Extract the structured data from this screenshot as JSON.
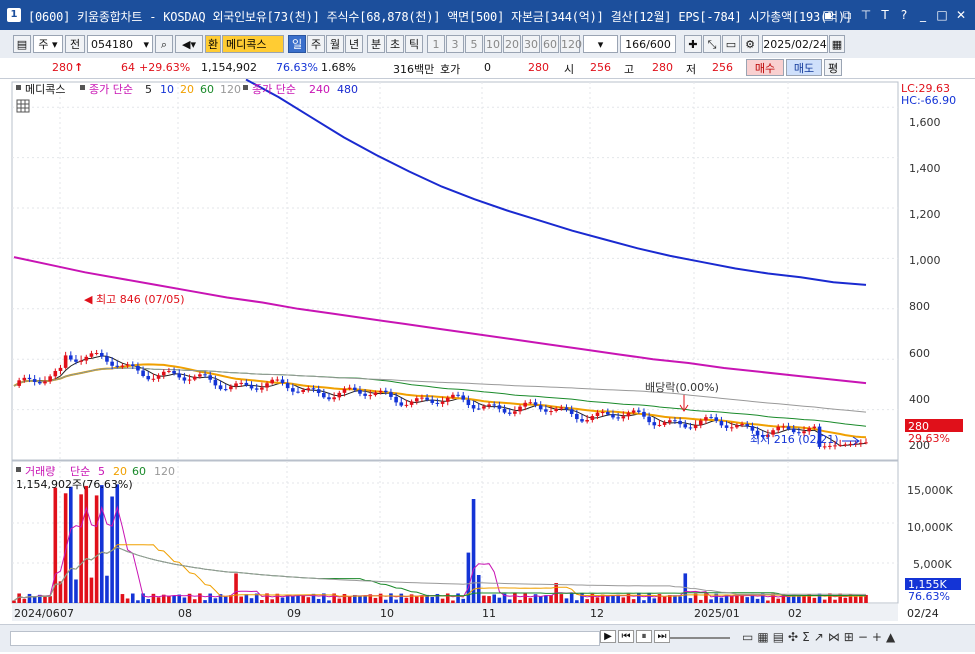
{
  "window": {
    "number": "1",
    "title": "[0600] 키움종합차트 - KOSDAQ 외국인보유[73(천)] 주식수[68,878(천)] 액면[500] 자본금[344(억)] 결산[12월] EPS[-784] 시가총액[193(억)]",
    "buttons": [
      "▣",
      "⧉",
      "⊤",
      "T",
      "?",
      "_",
      "□",
      "✕"
    ]
  },
  "toolbar": {
    "period_select": "주",
    "prev_label": "전",
    "code": "054180",
    "exchange_label": "환",
    "stock_name": "메디콕스",
    "period_tabs": [
      "일",
      "주",
      "월",
      "년",
      "분",
      "초",
      "틱"
    ],
    "active_period": "일",
    "minute_options": [
      "1",
      "3",
      "5",
      "10",
      "20",
      "30",
      "60",
      "120"
    ],
    "count_value": "166",
    "count_max": "/600",
    "date": "2025/02/24"
  },
  "quote": {
    "price": "280",
    "change": "64",
    "change_pct": "+29.63%",
    "volume": "1,154,902",
    "ratio1": "76.63%",
    "ratio2": "1.68%",
    "amount": "316백만",
    "hoga_label": "호가",
    "hoga_value": "0",
    "hoga_price": "280",
    "open_label": "시",
    "open": "256",
    "high_label": "고",
    "high": "280",
    "low_label": "저",
    "low": "256",
    "buy_label": "매수",
    "sell_label": "매도",
    "eval_label": "평"
  },
  "colors": {
    "up": "#e0101a",
    "down": "#1434d6",
    "ma5": "#222222",
    "ma20": "#f0a000",
    "ma60": "#1a8a2a",
    "ma120": "#999999",
    "ma240": "#c814b4",
    "ma480": "#1a2ad0"
  },
  "price_panel": {
    "legend": {
      "name": "메디콕스",
      "ma_label": "종가 단순",
      "periods": [
        "5",
        "10",
        "20",
        "60",
        "120"
      ],
      "ma2_label": "종가 단순",
      "periods2": [
        "240",
        "480"
      ]
    },
    "lc": "LC:29.63",
    "hc": "HC:-66.90",
    "current_price_tag": "280",
    "current_pct_tag": "29.63%",
    "y_ticks": [
      "1,600",
      "1,400",
      "1,200",
      "1,000",
      "800",
      "600",
      "400",
      "200"
    ],
    "high_annotation": "최고 846 (07/05)",
    "low_annotation": "최저 216 (02/21)",
    "dividend_annotation": "배당락(0.00%)"
  },
  "volume_panel": {
    "legend_name": "거래량",
    "ma_label": "단순",
    "periods": [
      "5",
      "20",
      "60",
      "120"
    ],
    "value_label": "1,154,902주(76.63%)",
    "y_ticks": [
      "15,000K",
      "10,000K",
      "5,000K"
    ],
    "current_tag": "1,155K",
    "current_pct_tag": "76.63%"
  },
  "x_axis": {
    "labels": [
      "2024/06",
      "07",
      "08",
      "09",
      "10",
      "11",
      "12",
      "2025/01",
      "02"
    ],
    "last_date": "02/24"
  },
  "chart_data": {
    "type": "candlestick",
    "price_range": [
      200,
      1700
    ],
    "ma240": [
      1005,
      975,
      945,
      920,
      895,
      870,
      845,
      825,
      800,
      780,
      760,
      740,
      720,
      700,
      680,
      660,
      640,
      620,
      600,
      585,
      565,
      550,
      535,
      520,
      505
    ],
    "ma480": [
      1710,
      1640,
      1560,
      1480,
      1410,
      1345,
      1285,
      1235,
      1190,
      1150,
      1110,
      1075,
      1040,
      1010,
      985,
      960,
      940,
      925,
      905,
      895
    ],
    "volume_range": [
      0,
      17000
    ],
    "volume_ticks_k": [
      5000,
      10000,
      15000
    ]
  }
}
